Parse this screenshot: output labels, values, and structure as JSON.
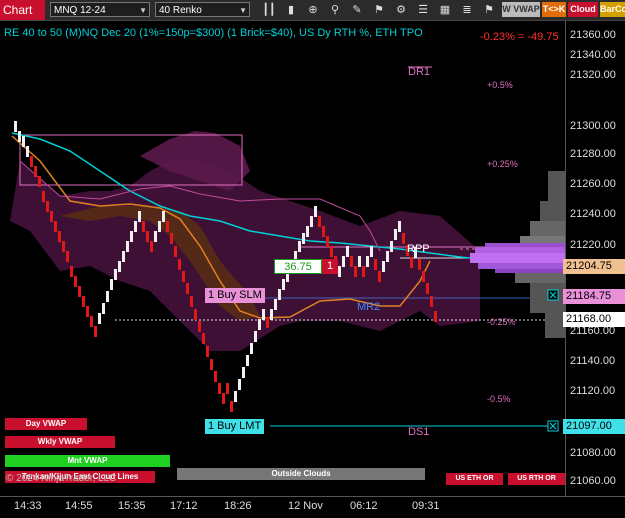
{
  "toolbar": {
    "chart_label": "Chart",
    "instrument": "MNQ 12-24",
    "period": "40 Renko",
    "wvwap": "W VWAP",
    "tk": "T<>K",
    "cloud": "Cloud",
    "barco": "BarCo",
    "icons": [
      "bars-icon",
      "candles-icon",
      "zoom-icon",
      "magnify-icon",
      "pencil-icon",
      "shapes-icon",
      "strategy-icon",
      "properties-icon",
      "window-icon"
    ]
  },
  "header": {
    "title": "RE 40 to 50 (M)NQ Dec 20 (1%=150p=$300) (1 Brick=$40), US Dy RTH %, ETH TPO",
    "change": "-0.23% = -49.75"
  },
  "levels": {
    "dr1": "DR1",
    "ds1": "DS1",
    "mr2": "MR2",
    "rpp": "RPP",
    "pct_05": "+0.5%",
    "pct_025": "+0.25%",
    "pct_m025": "-0.25%",
    "pct_m05": "-0.5%"
  },
  "orders": {
    "buy_slm": "1 Buy SLM",
    "buy_lmt": "1 Buy LMT",
    "pnl": "36.75",
    "qty": "1"
  },
  "price_axis": {
    "ticks": [
      "21360.00",
      "21340.00",
      "21320.00",
      "21300.00",
      "21280.00",
      "21260.00",
      "21240.00",
      "21220.00",
      "21184.75",
      "21168.00",
      "21160.00",
      "21140.00",
      "21120.00",
      "21097.00",
      "21080.00",
      "21060.00"
    ],
    "label_current": "21204.75",
    "label_slm": "21184.75",
    "label_last": "21168.00",
    "label_lmt": "21097.00"
  },
  "time_axis": [
    "14:33",
    "14:55",
    "15:35",
    "17:12",
    "18:26",
    "12 Nov",
    "06:12",
    "09:31"
  ],
  "bottom_buttons": {
    "day_vwap": "Day VWAP",
    "wkly_vwap": "Wkly VWAP",
    "mnt_vwap": "Mnt VWAP",
    "outside_clouds": "Outside Clouds",
    "copyright": "© 2024 NinjaTrader, LLC",
    "us_eth_or": "US ETH OR",
    "us_rth_or": "US RTH OR",
    "tenkan_kijun": "Tenkan/Kijun East Cloud Lines"
  },
  "colors": {
    "accent_red": "#c8102e",
    "cloud_purple": "#6a1f5a",
    "cyan": "#00d0d8",
    "orange": "#e08020",
    "pink": "#e070c0"
  }
}
